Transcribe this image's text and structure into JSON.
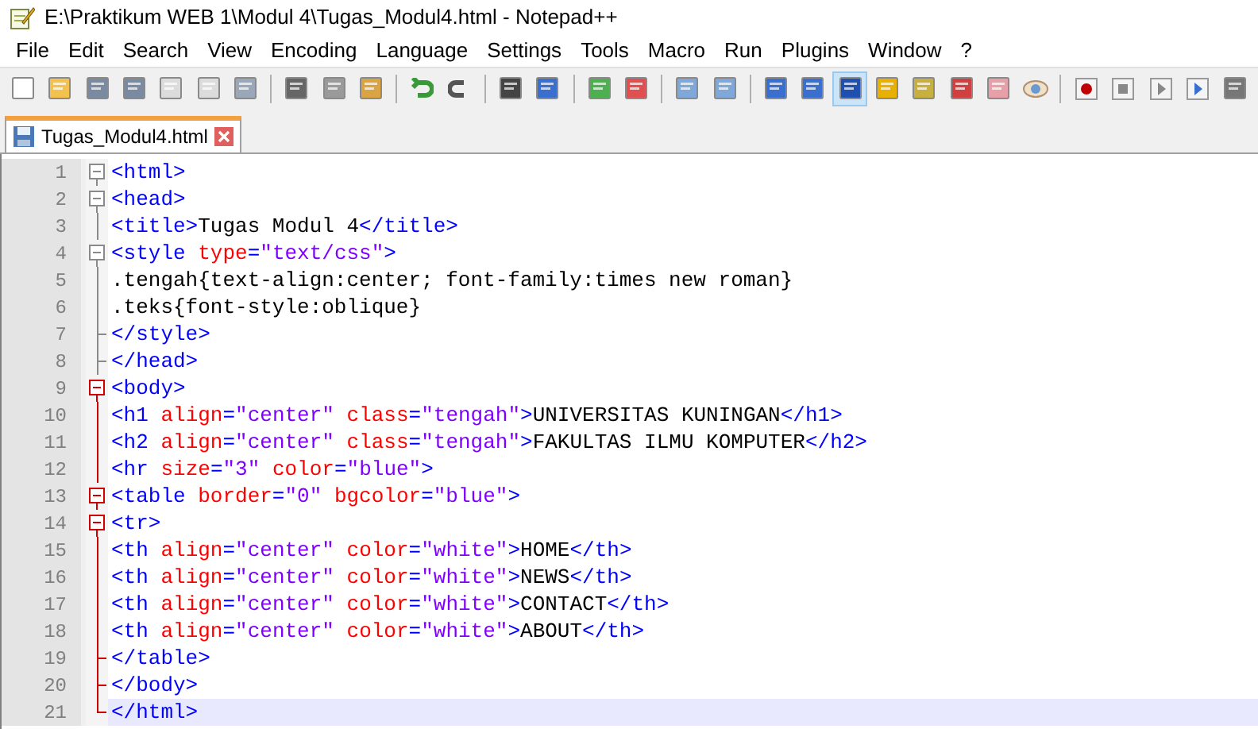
{
  "window": {
    "title": "E:\\Praktikum WEB 1\\Modul 4\\Tugas_Modul4.html - Notepad++"
  },
  "menu": [
    "File",
    "Edit",
    "Search",
    "View",
    "Encoding",
    "Language",
    "Settings",
    "Tools",
    "Macro",
    "Run",
    "Plugins",
    "Window",
    "?"
  ],
  "toolbar": [
    {
      "kind": "new",
      "selected": false
    },
    {
      "kind": "open",
      "selected": false
    },
    {
      "kind": "save",
      "selected": false
    },
    {
      "kind": "saveall",
      "selected": false
    },
    {
      "kind": "close",
      "selected": false
    },
    {
      "kind": "closeall",
      "selected": false
    },
    {
      "kind": "print",
      "selected": false
    },
    {
      "kind": "sep"
    },
    {
      "kind": "cut",
      "selected": false
    },
    {
      "kind": "copy",
      "selected": false
    },
    {
      "kind": "paste",
      "selected": false
    },
    {
      "kind": "sep"
    },
    {
      "kind": "undo",
      "selected": false
    },
    {
      "kind": "redo",
      "selected": false
    },
    {
      "kind": "sep"
    },
    {
      "kind": "find",
      "selected": false
    },
    {
      "kind": "replace",
      "selected": false
    },
    {
      "kind": "sep"
    },
    {
      "kind": "zoomin",
      "selected": false
    },
    {
      "kind": "zoomout",
      "selected": false
    },
    {
      "kind": "sep"
    },
    {
      "kind": "sync",
      "selected": false
    },
    {
      "kind": "sync",
      "selected": false
    },
    {
      "kind": "sep"
    },
    {
      "kind": "wrap",
      "selected": false
    },
    {
      "kind": "para",
      "selected": false
    },
    {
      "kind": "indent",
      "selected": true
    },
    {
      "kind": "lang",
      "selected": false
    },
    {
      "kind": "map",
      "selected": false
    },
    {
      "kind": "func",
      "selected": false
    },
    {
      "kind": "folder",
      "selected": false
    },
    {
      "kind": "eye",
      "selected": false
    },
    {
      "kind": "sep"
    },
    {
      "kind": "record",
      "selected": false
    },
    {
      "kind": "stop",
      "selected": false
    },
    {
      "kind": "play",
      "selected": false
    },
    {
      "kind": "playmany",
      "selected": false
    },
    {
      "kind": "savemacro",
      "selected": false
    }
  ],
  "tabs": [
    {
      "label": "Tugas_Modul4.html",
      "selected": true
    }
  ],
  "lines": [
    {
      "number": "1",
      "kind": "open",
      "fold_active": false,
      "current": false,
      "tokens": [
        {
          "kind": "tag",
          "text": "<html>"
        }
      ]
    },
    {
      "number": "2",
      "kind": "open",
      "fold_active": false,
      "current": false,
      "tokens": [
        {
          "kind": "tag",
          "text": "<head>"
        }
      ]
    },
    {
      "number": "3",
      "kind": "line",
      "fold_active": false,
      "current": false,
      "tokens": [
        {
          "kind": "tag",
          "text": "<title>"
        },
        {
          "kind": "text",
          "text": "Tugas Modul 4"
        },
        {
          "kind": "tag",
          "text": "</title>"
        }
      ]
    },
    {
      "number": "4",
      "kind": "open",
      "fold_active": false,
      "current": false,
      "tokens": [
        {
          "kind": "tag",
          "text": "<style "
        },
        {
          "kind": "attr",
          "text": "type"
        },
        {
          "kind": "tag",
          "text": "="
        },
        {
          "kind": "value",
          "text": "\"text/css\""
        },
        {
          "kind": "tag",
          "text": ">"
        }
      ]
    },
    {
      "number": "5",
      "kind": "line",
      "fold_active": false,
      "current": false,
      "tokens": [
        {
          "kind": "text",
          "text": ".tengah{text-align:center; font-family:times new roman}"
        }
      ]
    },
    {
      "number": "6",
      "kind": "line",
      "fold_active": false,
      "current": false,
      "tokens": [
        {
          "kind": "text",
          "text": ".teks{font-style:oblique}"
        }
      ]
    },
    {
      "number": "7",
      "kind": "tee",
      "fold_active": false,
      "current": false,
      "tokens": [
        {
          "kind": "tag",
          "text": "</style>"
        }
      ]
    },
    {
      "number": "8",
      "kind": "tee",
      "fold_active": false,
      "current": false,
      "tokens": [
        {
          "kind": "tag",
          "text": "</head>"
        }
      ]
    },
    {
      "number": "9",
      "kind": "open",
      "fold_active": true,
      "current": false,
      "tokens": [
        {
          "kind": "tag",
          "text": "<body>"
        }
      ]
    },
    {
      "number": "10",
      "kind": "line",
      "fold_active": true,
      "current": false,
      "tokens": [
        {
          "kind": "tag",
          "text": "<h1 "
        },
        {
          "kind": "attr",
          "text": "align"
        },
        {
          "kind": "tag",
          "text": "="
        },
        {
          "kind": "value",
          "text": "\"center\" "
        },
        {
          "kind": "attr",
          "text": "class"
        },
        {
          "kind": "tag",
          "text": "="
        },
        {
          "kind": "value",
          "text": "\"tengah\""
        },
        {
          "kind": "tag",
          "text": ">"
        },
        {
          "kind": "text",
          "text": "UNIVERSITAS KUNINGAN"
        },
        {
          "kind": "tag",
          "text": "</h1>"
        }
      ]
    },
    {
      "number": "11",
      "kind": "line",
      "fold_active": true,
      "current": false,
      "tokens": [
        {
          "kind": "tag",
          "text": "<h2 "
        },
        {
          "kind": "attr",
          "text": "align"
        },
        {
          "kind": "tag",
          "text": "="
        },
        {
          "kind": "value",
          "text": "\"center\" "
        },
        {
          "kind": "attr",
          "text": "class"
        },
        {
          "kind": "tag",
          "text": "="
        },
        {
          "kind": "value",
          "text": "\"tengah\""
        },
        {
          "kind": "tag",
          "text": ">"
        },
        {
          "kind": "text",
          "text": "FAKULTAS ILMU KOMPUTER"
        },
        {
          "kind": "tag",
          "text": "</h2>"
        }
      ]
    },
    {
      "number": "12",
      "kind": "line",
      "fold_active": true,
      "current": false,
      "tokens": [
        {
          "kind": "tag",
          "text": "<hr "
        },
        {
          "kind": "attr",
          "text": "size"
        },
        {
          "kind": "tag",
          "text": "="
        },
        {
          "kind": "value",
          "text": "\"3\" "
        },
        {
          "kind": "attr",
          "text": "color"
        },
        {
          "kind": "tag",
          "text": "="
        },
        {
          "kind": "value",
          "text": "\"blue\""
        },
        {
          "kind": "tag",
          "text": ">"
        }
      ]
    },
    {
      "number": "13",
      "kind": "open",
      "fold_active": true,
      "current": false,
      "tokens": [
        {
          "kind": "tag",
          "text": "<table "
        },
        {
          "kind": "attr",
          "text": "border"
        },
        {
          "kind": "tag",
          "text": "="
        },
        {
          "kind": "value",
          "text": "\"0\" "
        },
        {
          "kind": "attr",
          "text": "bgcolor"
        },
        {
          "kind": "tag",
          "text": "="
        },
        {
          "kind": "value",
          "text": "\"blue\""
        },
        {
          "kind": "tag",
          "text": ">"
        }
      ]
    },
    {
      "number": "14",
      "kind": "open",
      "fold_active": true,
      "current": false,
      "tokens": [
        {
          "kind": "tag",
          "text": "<tr>"
        }
      ]
    },
    {
      "number": "15",
      "kind": "line",
      "fold_active": true,
      "current": false,
      "tokens": [
        {
          "kind": "tag",
          "text": "<th "
        },
        {
          "kind": "attr",
          "text": "align"
        },
        {
          "kind": "tag",
          "text": "="
        },
        {
          "kind": "value",
          "text": "\"center\" "
        },
        {
          "kind": "attr",
          "text": "color"
        },
        {
          "kind": "tag",
          "text": "="
        },
        {
          "kind": "value",
          "text": "\"white\""
        },
        {
          "kind": "tag",
          "text": ">"
        },
        {
          "kind": "text",
          "text": "HOME"
        },
        {
          "kind": "tag",
          "text": "</th>"
        }
      ]
    },
    {
      "number": "16",
      "kind": "line",
      "fold_active": true,
      "current": false,
      "tokens": [
        {
          "kind": "tag",
          "text": "<th "
        },
        {
          "kind": "attr",
          "text": "align"
        },
        {
          "kind": "tag",
          "text": "="
        },
        {
          "kind": "value",
          "text": "\"center\" "
        },
        {
          "kind": "attr",
          "text": "color"
        },
        {
          "kind": "tag",
          "text": "="
        },
        {
          "kind": "value",
          "text": "\"white\""
        },
        {
          "kind": "tag",
          "text": ">"
        },
        {
          "kind": "text",
          "text": "NEWS"
        },
        {
          "kind": "tag",
          "text": "</th>"
        }
      ]
    },
    {
      "number": "17",
      "kind": "line",
      "fold_active": true,
      "current": false,
      "tokens": [
        {
          "kind": "tag",
          "text": "<th "
        },
        {
          "kind": "attr",
          "text": "align"
        },
        {
          "kind": "tag",
          "text": "="
        },
        {
          "kind": "value",
          "text": "\"center\" "
        },
        {
          "kind": "attr",
          "text": "color"
        },
        {
          "kind": "tag",
          "text": "="
        },
        {
          "kind": "value",
          "text": "\"white\""
        },
        {
          "kind": "tag",
          "text": ">"
        },
        {
          "kind": "text",
          "text": "CONTACT"
        },
        {
          "kind": "tag",
          "text": "</th>"
        }
      ]
    },
    {
      "number": "18",
      "kind": "line",
      "fold_active": true,
      "current": false,
      "tokens": [
        {
          "kind": "tag",
          "text": "<th "
        },
        {
          "kind": "attr",
          "text": "align"
        },
        {
          "kind": "tag",
          "text": "="
        },
        {
          "kind": "value",
          "text": "\"center\" "
        },
        {
          "kind": "attr",
          "text": "color"
        },
        {
          "kind": "tag",
          "text": "="
        },
        {
          "kind": "value",
          "text": "\"white\""
        },
        {
          "kind": "tag",
          "text": ">"
        },
        {
          "kind": "text",
          "text": "ABOUT"
        },
        {
          "kind": "tag",
          "text": "</th>"
        }
      ]
    },
    {
      "number": "19",
      "kind": "tee",
      "fold_active": true,
      "current": false,
      "tokens": [
        {
          "kind": "tag",
          "text": "</table>"
        }
      ]
    },
    {
      "number": "20",
      "kind": "tee",
      "fold_active": true,
      "current": false,
      "tokens": [
        {
          "kind": "tag",
          "text": "</body>"
        }
      ]
    },
    {
      "number": "21",
      "kind": "end",
      "fold_active": true,
      "current": true,
      "tokens": [
        {
          "kind": "tag",
          "text": "</html>"
        }
      ]
    }
  ]
}
